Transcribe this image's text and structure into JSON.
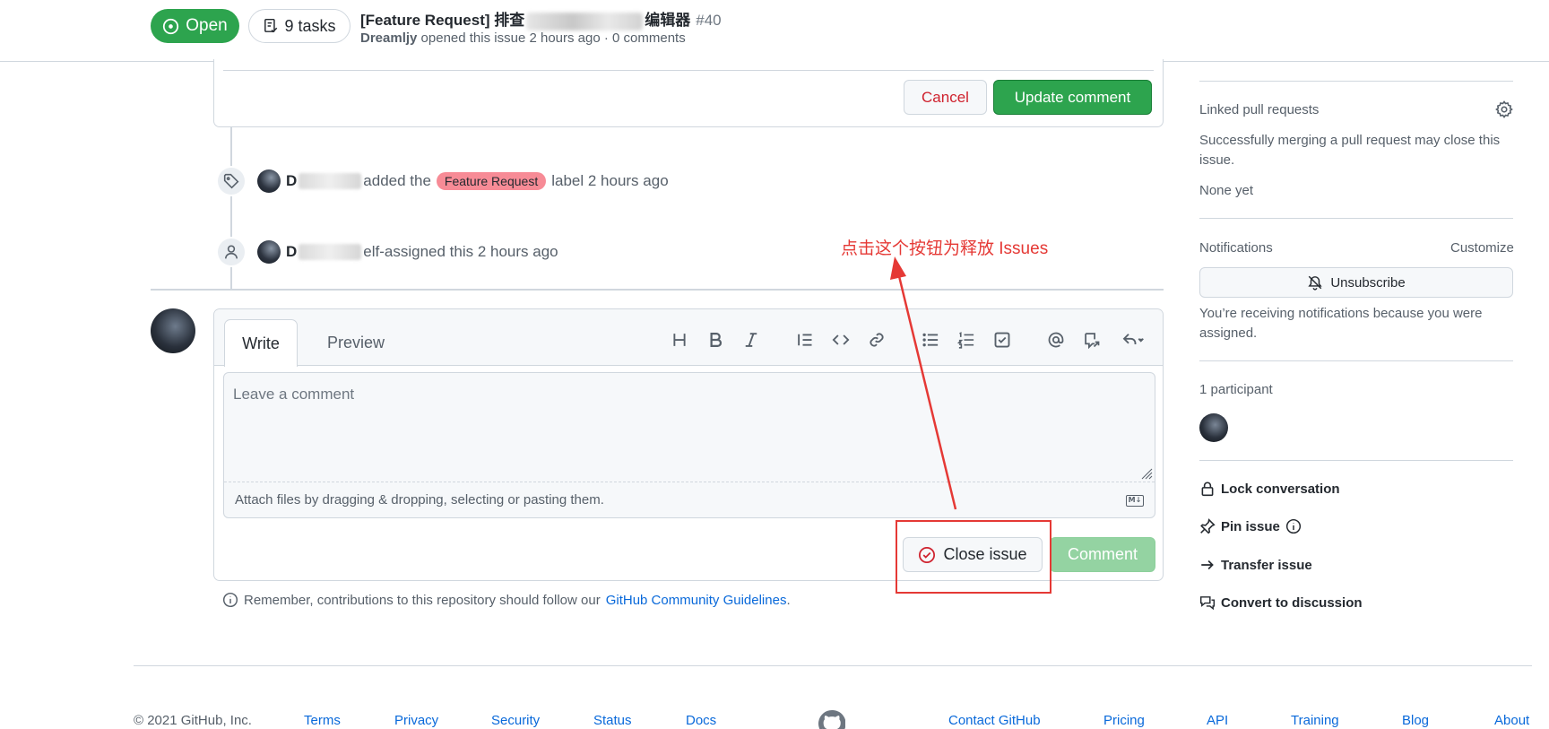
{
  "header": {
    "status": "Open",
    "tasks": "9 tasks",
    "title_prefix": "[Feature Request] 排查",
    "title_suffix": "编辑器",
    "issue_number": "#40",
    "author": "Dreamljy",
    "meta": "opened this issue 2 hours ago · 0 comments"
  },
  "edit": {
    "cancel_label": "Cancel",
    "update_label": "Update comment"
  },
  "timeline": {
    "label_event": {
      "author_initial": "D",
      "action": "added the",
      "label": "Feature Request",
      "suffix": "label 2 hours ago"
    },
    "assign_event": {
      "author_initial": "D",
      "action": "elf-assigned this 2 hours ago"
    }
  },
  "comment": {
    "tab_write": "Write",
    "tab_preview": "Preview",
    "placeholder": "Leave a comment",
    "attach_hint": "Attach files by dragging & dropping, selecting or pasting them.",
    "md_badge": "M↓",
    "close_label": "Close issue",
    "comment_label": "Comment"
  },
  "remember": {
    "text": "Remember, contributions to this repository should follow our",
    "link": "GitHub Community Guidelines",
    "end": "."
  },
  "annotation": {
    "text": "点击这个按钮为释放 Issues",
    "color": "#e53935"
  },
  "sidebar": {
    "linked_heading": "Linked pull requests",
    "linked_desc": "Successfully merging a pull request may close this issue.",
    "none_yet": "None yet",
    "notif_heading": "Notifications",
    "customize": "Customize",
    "unsubscribe": "Unsubscribe",
    "notif_reason": "You’re receiving notifications because you were assigned.",
    "participants": "1 participant",
    "lock": "Lock conversation",
    "pin": "Pin issue",
    "transfer": "Transfer issue",
    "convert": "Convert to discussion"
  },
  "footer": {
    "copyright": "© 2021 GitHub, Inc.",
    "links": [
      "Terms",
      "Privacy",
      "Security",
      "Status",
      "Docs",
      "Contact GitHub",
      "Pricing",
      "API",
      "Training",
      "Blog",
      "About"
    ]
  },
  "colors": {
    "green": "#2da44e",
    "link": "#0969da",
    "label": "#f78b96",
    "annotation": "#e53935"
  }
}
